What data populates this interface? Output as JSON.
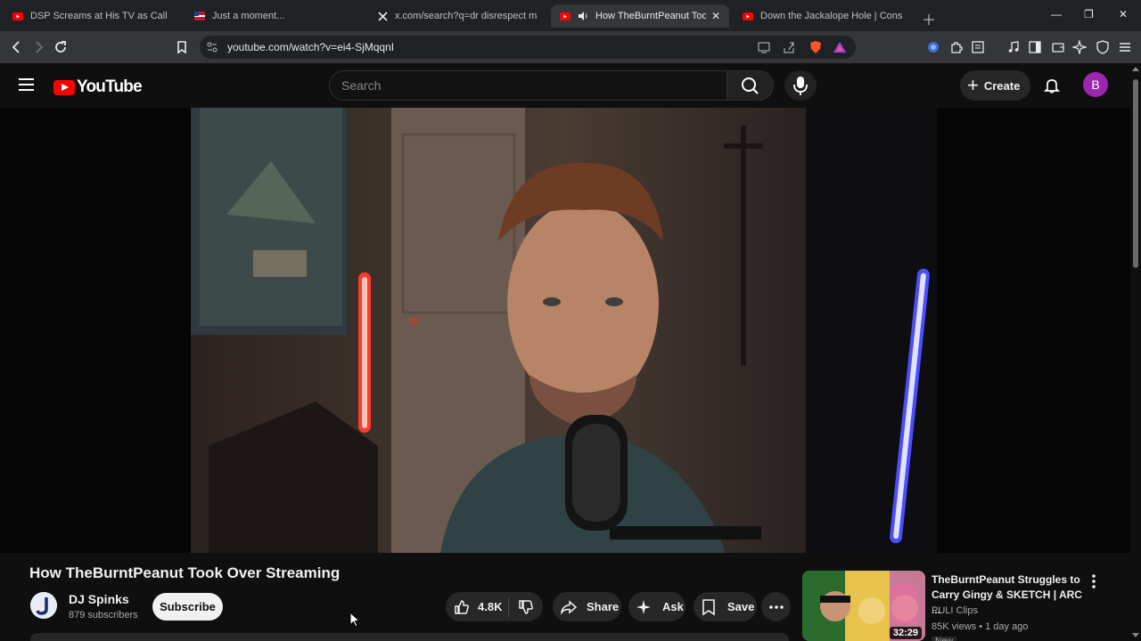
{
  "browser": {
    "tabs": [
      {
        "title": "DSP Screams at His TV as Call of Dut",
        "favicon": "youtube-icon",
        "active": false
      },
      {
        "title": "Just a moment...",
        "favicon": "flag-icon",
        "active": false
      },
      {
        "title": "x.com/search?q=dr disrespect madur",
        "favicon": "x-icon",
        "active": false
      },
      {
        "title": "How TheBurntPeanut Took Ov",
        "favicon": "youtube-icon",
        "active": true,
        "audio": true
      },
      {
        "title": "Down the Jackalope Hole | Conspirac",
        "favicon": "youtube-icon",
        "active": false
      }
    ],
    "url": "youtube.com/watch?v=ei4-SjMqqnI"
  },
  "header": {
    "logo_text": "YouTube",
    "search_placeholder": "Search",
    "create_label": "Create",
    "avatar_letter": "B"
  },
  "video": {
    "title": "How TheBurntPeanut Took Over Streaming",
    "channel": {
      "name": "DJ Spinks",
      "subscribers": "879 subscribers",
      "subscribe_label": "Subscribe"
    },
    "actions": {
      "likes": "4.8K",
      "share_label": "Share",
      "ask_label": "Ask",
      "save_label": "Save"
    }
  },
  "recommendation": {
    "title": "TheBurntPeanut Struggles to Carry Gingy & SKETCH | ARC ...",
    "channel": "PULI Clips",
    "meta": "85K views • 1 day ago",
    "duration": "32:29",
    "badge": "New"
  },
  "colors": {
    "youtube_red": "#ff0000",
    "avatar_purple": "#9b27af",
    "background": "#0f0f0f"
  }
}
